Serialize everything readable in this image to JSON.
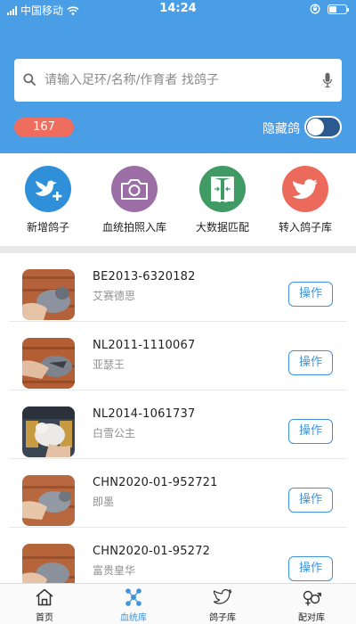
{
  "status_bar": {
    "carrier": "中国移动",
    "time": "14:24"
  },
  "search": {
    "placeholder": "请输入足环/名称/作育者 找鸽子"
  },
  "filters": {
    "count": "167",
    "hide_label": "隐藏鸽"
  },
  "quick_actions": [
    {
      "label": "新增鸽子",
      "icon": "add-pigeon-icon",
      "color": "#2f8fd8"
    },
    {
      "label": "血统拍照入库",
      "icon": "camera-icon",
      "color": "#9b6fa6"
    },
    {
      "label": "大数据匹配",
      "icon": "match-door-icon",
      "color": "#3f9a63"
    },
    {
      "label": "转入鸽子库",
      "icon": "bird-icon",
      "color": "#ec6a5c"
    }
  ],
  "pigeons": [
    {
      "ring": "BE2013-6320182",
      "name": "艾赛德思",
      "action": "操作"
    },
    {
      "ring": "NL2011-1110067",
      "name": "亚瑟王",
      "action": "操作"
    },
    {
      "ring": "NL2014-1061737",
      "name": "白雪公主",
      "action": "操作"
    },
    {
      "ring": "CHN2020-01-952721",
      "name": "即墨",
      "action": "操作"
    },
    {
      "ring": "CHN2020-01-95272",
      "name": "富贵皇华",
      "action": "操作"
    }
  ],
  "tabs": [
    {
      "label": "首页",
      "icon": "home-icon",
      "active": false
    },
    {
      "label": "血统库",
      "icon": "pedigree-icon",
      "active": true
    },
    {
      "label": "鸽子库",
      "icon": "bird-icon",
      "active": false
    },
    {
      "label": "配对库",
      "icon": "pairing-icon",
      "active": false
    }
  ],
  "colors": {
    "header": "#4a9ee6",
    "accent": "#3f93dd",
    "badge": "#ee6d5e"
  }
}
